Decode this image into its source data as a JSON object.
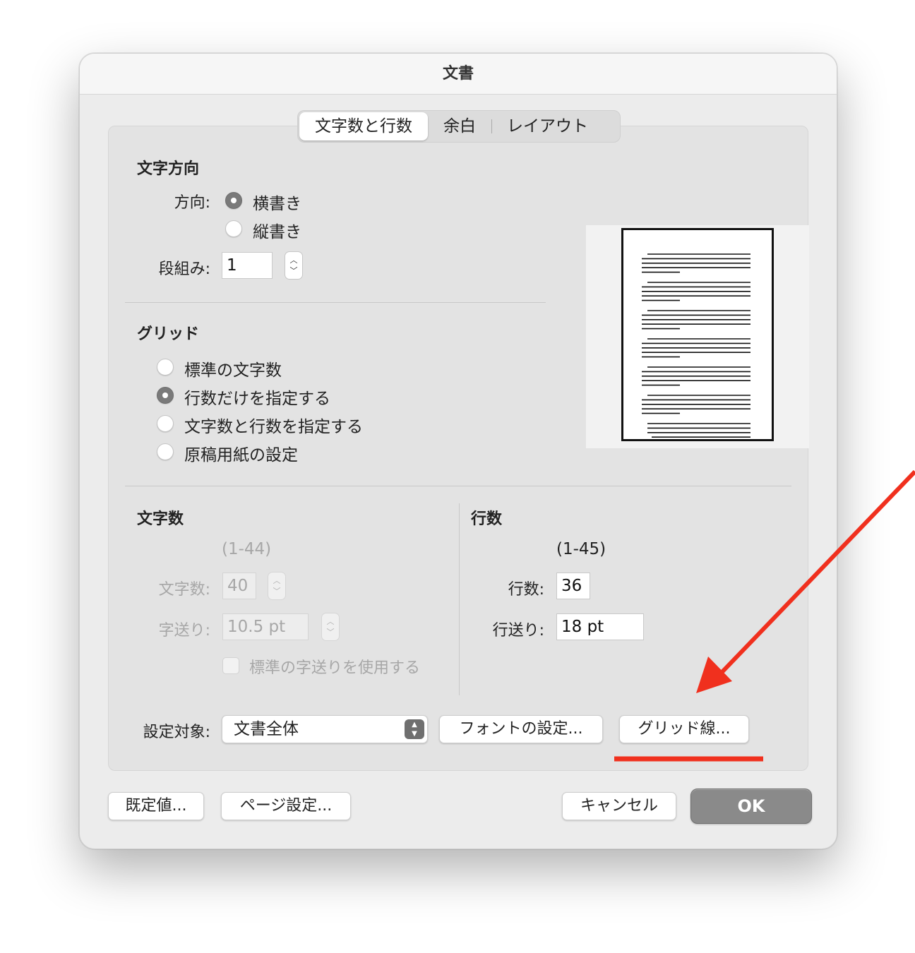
{
  "window": {
    "title": "文書"
  },
  "tabs": [
    {
      "label": "文字数と行数",
      "active": true
    },
    {
      "label": "余白",
      "active": false
    },
    {
      "label": "レイアウト",
      "active": false
    }
  ],
  "direction": {
    "heading": "文字方向",
    "direction_label": "方向:",
    "options": [
      {
        "label": "横書き",
        "selected": true
      },
      {
        "label": "縦書き",
        "selected": false
      }
    ],
    "columns_label": "段組み:",
    "columns_value": "1"
  },
  "grid": {
    "heading": "グリッド",
    "options": [
      {
        "label": "標準の文字数",
        "selected": false
      },
      {
        "label": "行数だけを指定する",
        "selected": true
      },
      {
        "label": "文字数と行数を指定する",
        "selected": false
      },
      {
        "label": "原稿用紙の設定",
        "selected": false
      }
    ]
  },
  "chars": {
    "heading": "文字数",
    "range": "(1-44)",
    "count_label": "文字数:",
    "count_value": "40",
    "pitch_label": "字送り:",
    "pitch_value": "10.5 pt",
    "default_pitch_label": "標準の字送りを使用する",
    "enabled": false
  },
  "lines": {
    "heading": "行数",
    "range": "(1-45)",
    "count_label": "行数:",
    "count_value": "36",
    "pitch_label": "行送り:",
    "pitch_value": "18 pt"
  },
  "apply": {
    "label": "設定対象:",
    "value": "文書全体"
  },
  "buttons": {
    "font_settings": "フォントの設定...",
    "grid_lines": "グリッド線...",
    "defaults": "既定値...",
    "page_setup": "ページ設定...",
    "cancel": "キャンセル",
    "ok": "OK"
  },
  "annotation": {
    "color": "#f0301e"
  }
}
